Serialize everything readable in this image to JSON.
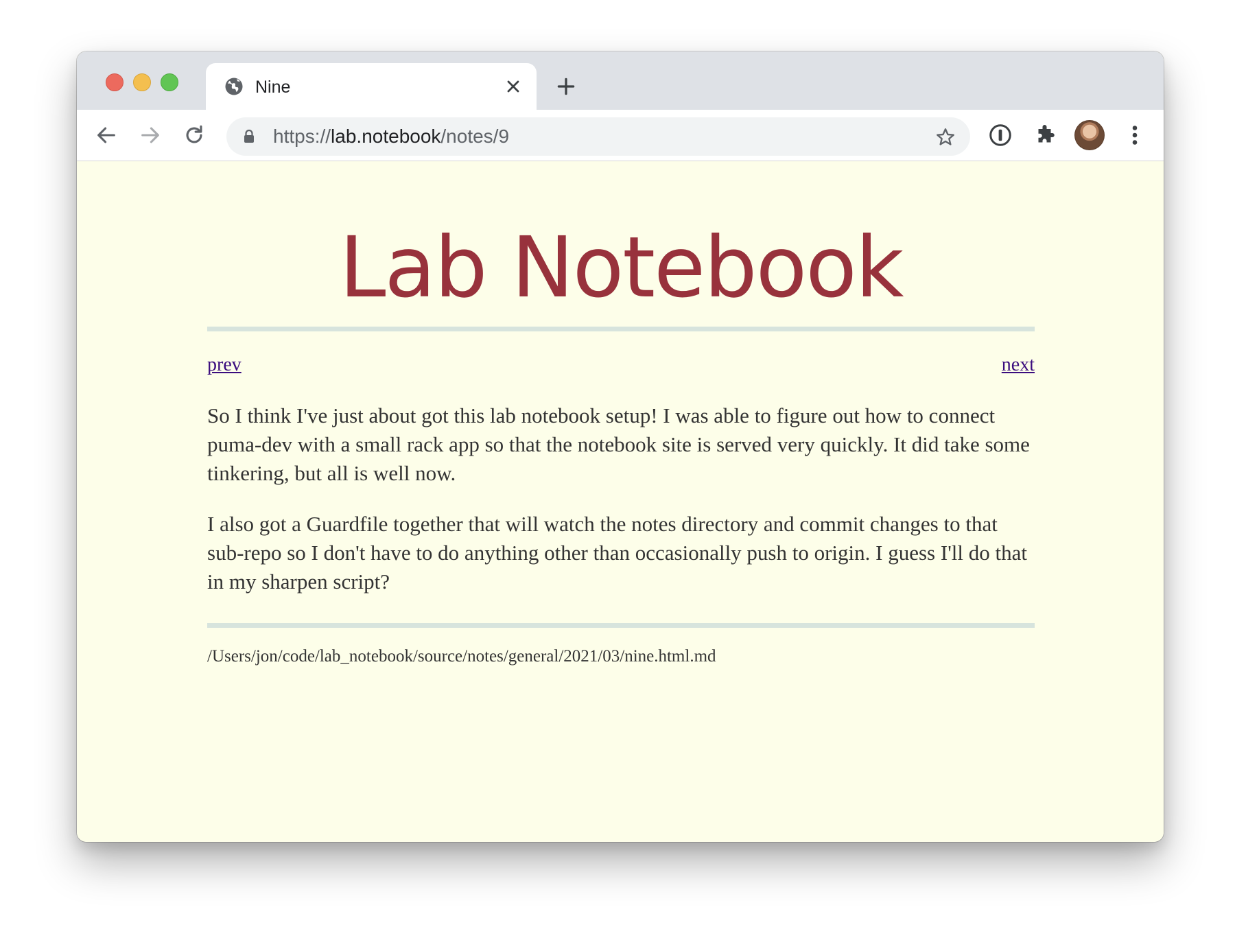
{
  "browser": {
    "tab": {
      "title": "Nine"
    },
    "url": {
      "scheme": "https://",
      "host": "lab.notebook",
      "path": "/notes/9"
    }
  },
  "page": {
    "site_title": "Lab Notebook",
    "nav": {
      "prev_label": "prev",
      "next_label": "next"
    },
    "paragraphs": [
      "So I think I've just about got this lab notebook setup! I was able to figure out how to connect puma-dev with a small rack app so that the notebook site is served very quickly. It did take some tinkering, but all is well now.",
      "I also got a Guardfile together that will watch the notes directory and commit changes to that sub-repo so I don't have to do anything other than occasionally push to origin. I guess I'll do that in my sharpen script?"
    ],
    "source_path": "/Users/jon/code/lab_notebook/source/notes/general/2021/03/nine.html.md"
  },
  "colors": {
    "page_background": "#fdfee9",
    "title": "#98323c",
    "rule": "#d7e4dd",
    "link": "#3a0c7e",
    "body_text": "#333333"
  },
  "icons": {
    "tab": "globe-icon",
    "toolbar": [
      "back-icon",
      "forward-icon",
      "reload-icon",
      "lock-icon",
      "star-icon",
      "password-icon",
      "extensions-icon",
      "avatar",
      "menu-icon"
    ]
  }
}
